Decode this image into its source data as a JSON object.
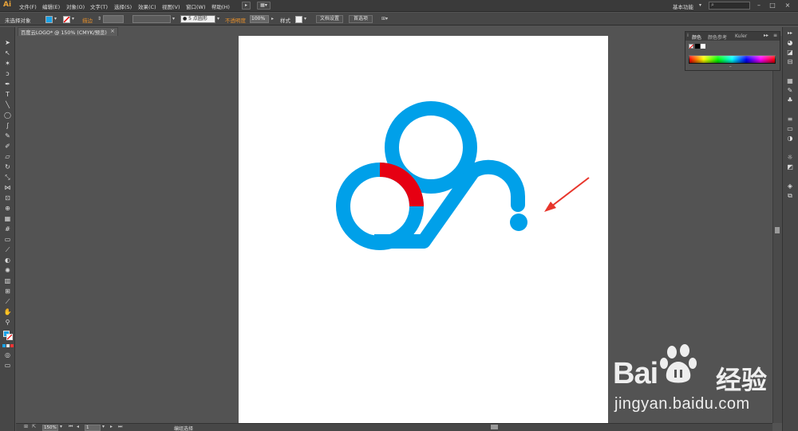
{
  "app": {
    "logo": "Ai"
  },
  "menubar": {
    "items": [
      "文件(F)",
      "编辑(E)",
      "对象(O)",
      "文字(T)",
      "选择(S)",
      "效果(C)",
      "视图(V)",
      "窗口(W)",
      "帮助(H)"
    ],
    "workspace_label": "基本功能",
    "window_controls": [
      "–",
      "□",
      "×"
    ]
  },
  "controlbar": {
    "selection_label": "未选择对象",
    "stroke_label": "描边",
    "stroke_weight_value": "",
    "brush_label": "5 点圆形",
    "opacity_label": "不透明度",
    "opacity_value": "100%",
    "style_label": "样式",
    "doc_setup_label": "文档设置",
    "prefs_label": "首选项"
  },
  "document_tab": {
    "label": "百度云LOGO* @ 150% (CMYK/预览)",
    "close": "×"
  },
  "color_panel": {
    "tabs": [
      "颜色",
      "颜色参考",
      "Kuler"
    ]
  },
  "statusbar": {
    "zoom": "150%",
    "page": "1",
    "status_text": "编组选择"
  },
  "artwork": {
    "logo_color": "#00a0e9",
    "highlight_color": "#e60012",
    "arrow_color": "#e8362c"
  },
  "watermark": {
    "brand_bai": "Bai",
    "brand_du": "经验",
    "url": "jingyan.baidu.com"
  }
}
